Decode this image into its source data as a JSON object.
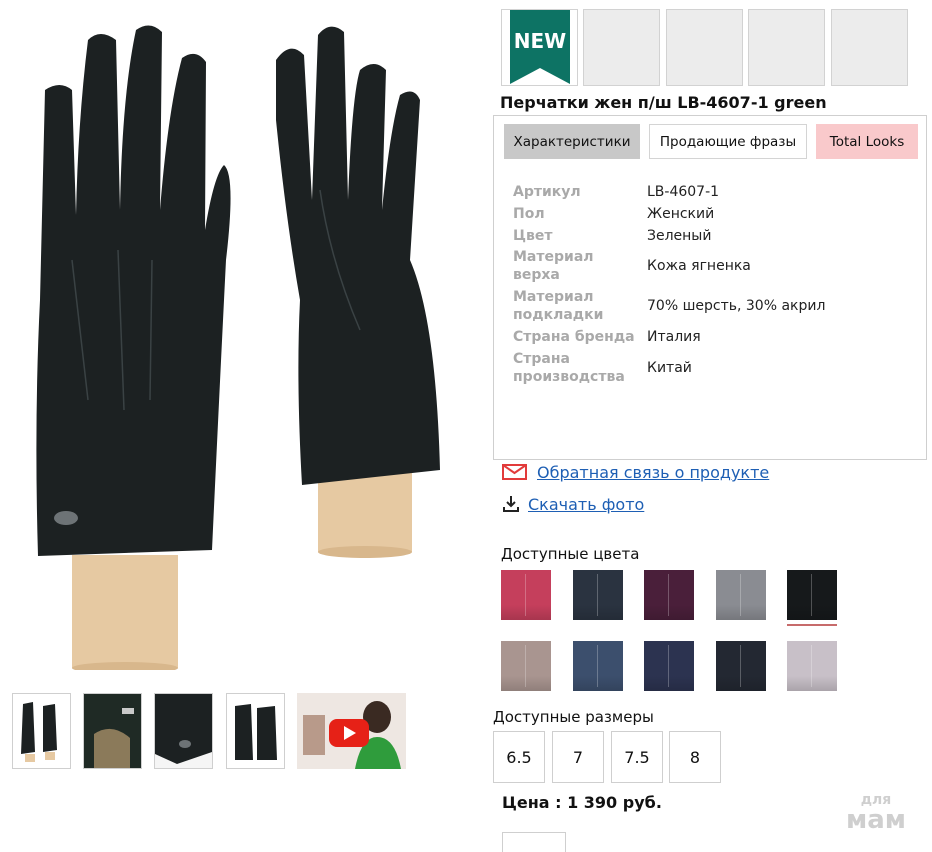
{
  "product": {
    "title": "Перчатки жен п/ш LB-4607-1 green",
    "badge": "NEW"
  },
  "tabs": [
    {
      "label": "Характеристики",
      "active": true
    },
    {
      "label": "Продающие фразы",
      "active": false
    },
    {
      "label": "Total Looks",
      "active": false
    }
  ],
  "specs": [
    {
      "label": "Артикул",
      "value": "LB-4607-1"
    },
    {
      "label": "Пол",
      "value": "Женский"
    },
    {
      "label": "Цвет",
      "value": "Зеленый"
    },
    {
      "label": "Материал верха",
      "value": "Кожа ягненка"
    },
    {
      "label": "Материал подкладки",
      "value": "70% шерсть, 30% акрил"
    },
    {
      "label": "Страна бренда",
      "value": "Италия"
    },
    {
      "label": "Страна производства",
      "value": "Китай"
    }
  ],
  "links": {
    "feedback": "Обратная связь о продукте",
    "download": "Скачать фото"
  },
  "colors": {
    "title": "Доступные цвета",
    "swatches": [
      "#c53f5c",
      "#2a3340",
      "#4a1f3a",
      "#8a8c92",
      "#16191b",
      "#a99590",
      "#3c4f6d",
      "#2c3350",
      "#232832",
      "#c8c0c8"
    ],
    "selected_index": 4
  },
  "sizes": {
    "title": "Доступные размеры",
    "options": [
      "6.5",
      "7",
      "7.5",
      "8"
    ]
  },
  "price": "Цена : 1 390 руб.",
  "watermark": {
    "line1": "для",
    "line2": "мам"
  },
  "icons": {
    "feedback": "mail-icon",
    "download": "download-icon",
    "video": "play-icon"
  }
}
